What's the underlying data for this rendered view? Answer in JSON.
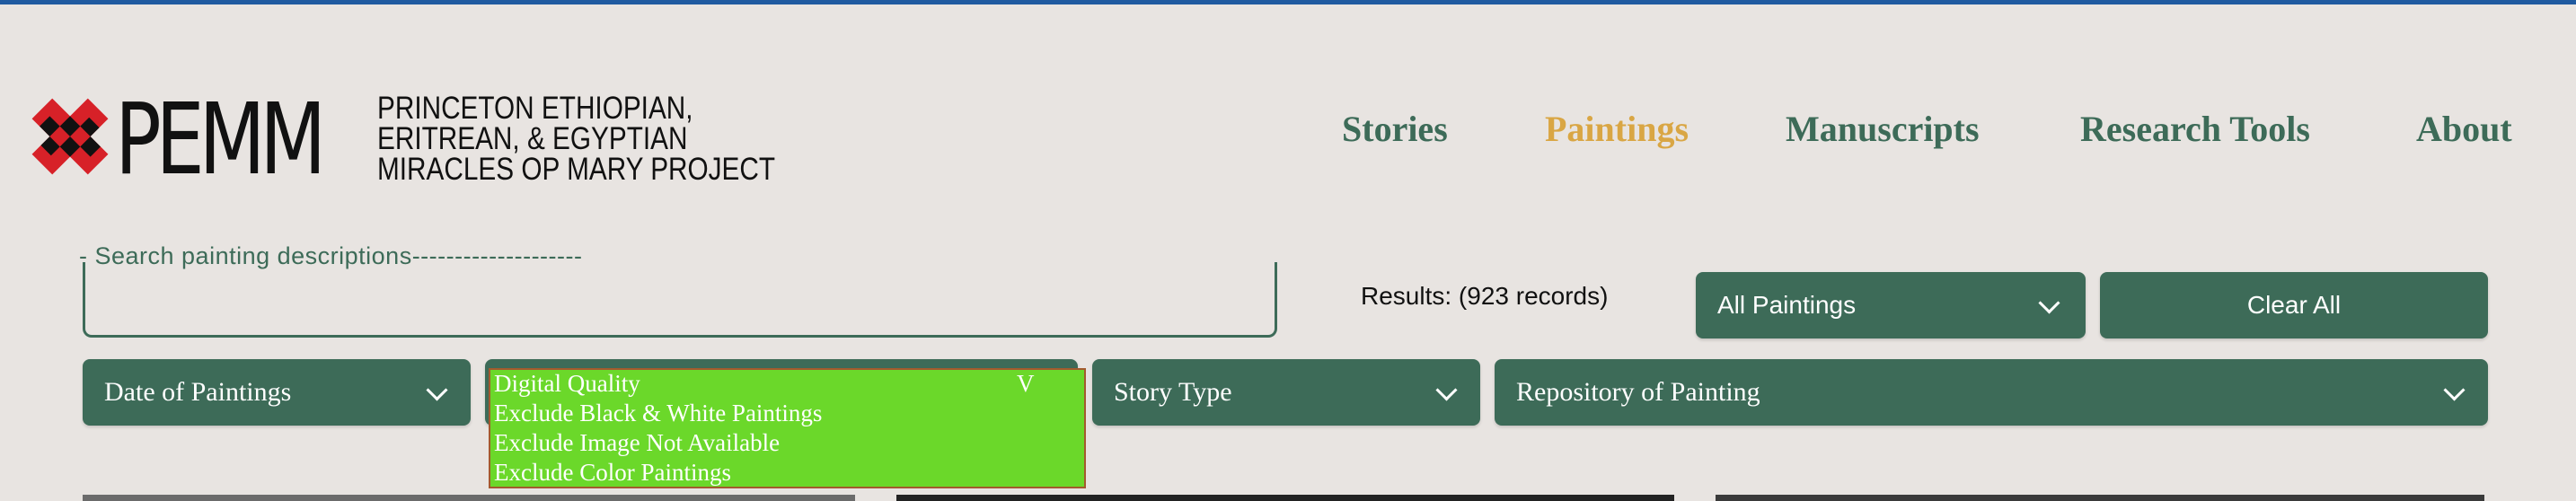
{
  "brand": {
    "acronym": "PEMM",
    "subtitle_lines": [
      "PRINCETON ETHIOPIAN,",
      "ERITREAN, & EGYPTIAN",
      "MIRACLES OP MARY PROJECT"
    ],
    "logo_colors": {
      "red": "#d72128",
      "black": "#111111"
    }
  },
  "nav": {
    "items": [
      {
        "label": "Stories",
        "active": false
      },
      {
        "label": "Paintings",
        "active": true
      },
      {
        "label": "Manuscripts",
        "active": false
      },
      {
        "label": "Research Tools",
        "active": false
      },
      {
        "label": "About",
        "active": false
      }
    ],
    "color": "#3d6b58",
    "active_color": "#d9a644"
  },
  "search": {
    "legend": "-   Search painting descriptions--------------------",
    "value": ""
  },
  "results": {
    "text": "Results:  (923  records)"
  },
  "collection_select": {
    "selected": "All Paintings",
    "icon": "chevron-down-icon"
  },
  "clear_all": {
    "label": "Clear All"
  },
  "filters": {
    "date": {
      "label": "Date of Paintings",
      "icon": "chevron-down-icon"
    },
    "digital_quality": {
      "label": "Digital Quality",
      "caret": "V",
      "options": [
        "Exclude Black & White Paintings",
        "Exclude Image Not Available",
        "Exclude Color Paintings"
      ]
    },
    "story_type": {
      "label": "Story Type",
      "icon": "chevron-down-icon"
    },
    "repository": {
      "label": "Repository of Painting",
      "icon": "chevron-down-icon"
    }
  },
  "colors": {
    "primary_green": "#3d6b58",
    "background": "#e8e4e1",
    "top_bar": "#1f5aa0",
    "dropdown_green": "#6bd82a"
  }
}
